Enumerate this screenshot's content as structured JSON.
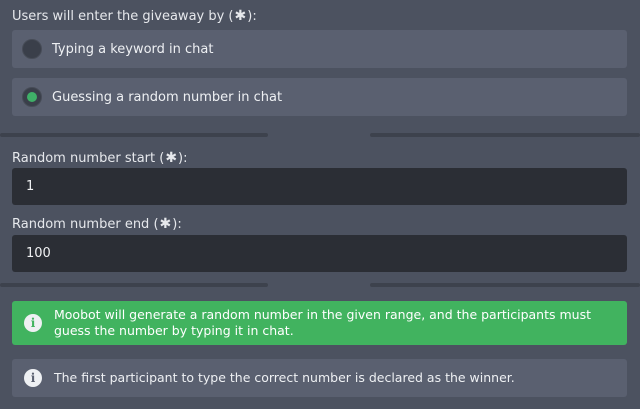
{
  "entry_method": {
    "label_prefix": "Users will enter the giveaway by (",
    "label_suffix": "):",
    "required_mark": "✱",
    "options": [
      {
        "label": "Typing a keyword in chat",
        "selected": false
      },
      {
        "label": "Guessing a random number in chat",
        "selected": true
      }
    ]
  },
  "range": {
    "start": {
      "label_prefix": "Random number start (",
      "label_suffix": "):",
      "required_mark": "✱",
      "value": "1"
    },
    "end": {
      "label_prefix": "Random number end (",
      "label_suffix": "):",
      "required_mark": "✱",
      "value": "100"
    }
  },
  "notes": {
    "success": {
      "icon": "info-icon",
      "text": "Moobot will generate a random number in the given range, and the participants must guess the number by typing it in chat."
    },
    "info": {
      "icon": "info-icon",
      "text": "The first participant to type the correct number is declared as the winner."
    }
  },
  "colors": {
    "background": "#4c5260",
    "panel": "#5a6070",
    "input": "#2b2e35",
    "accent_green": "#41b35f",
    "radio_dot": "#3fb068"
  }
}
